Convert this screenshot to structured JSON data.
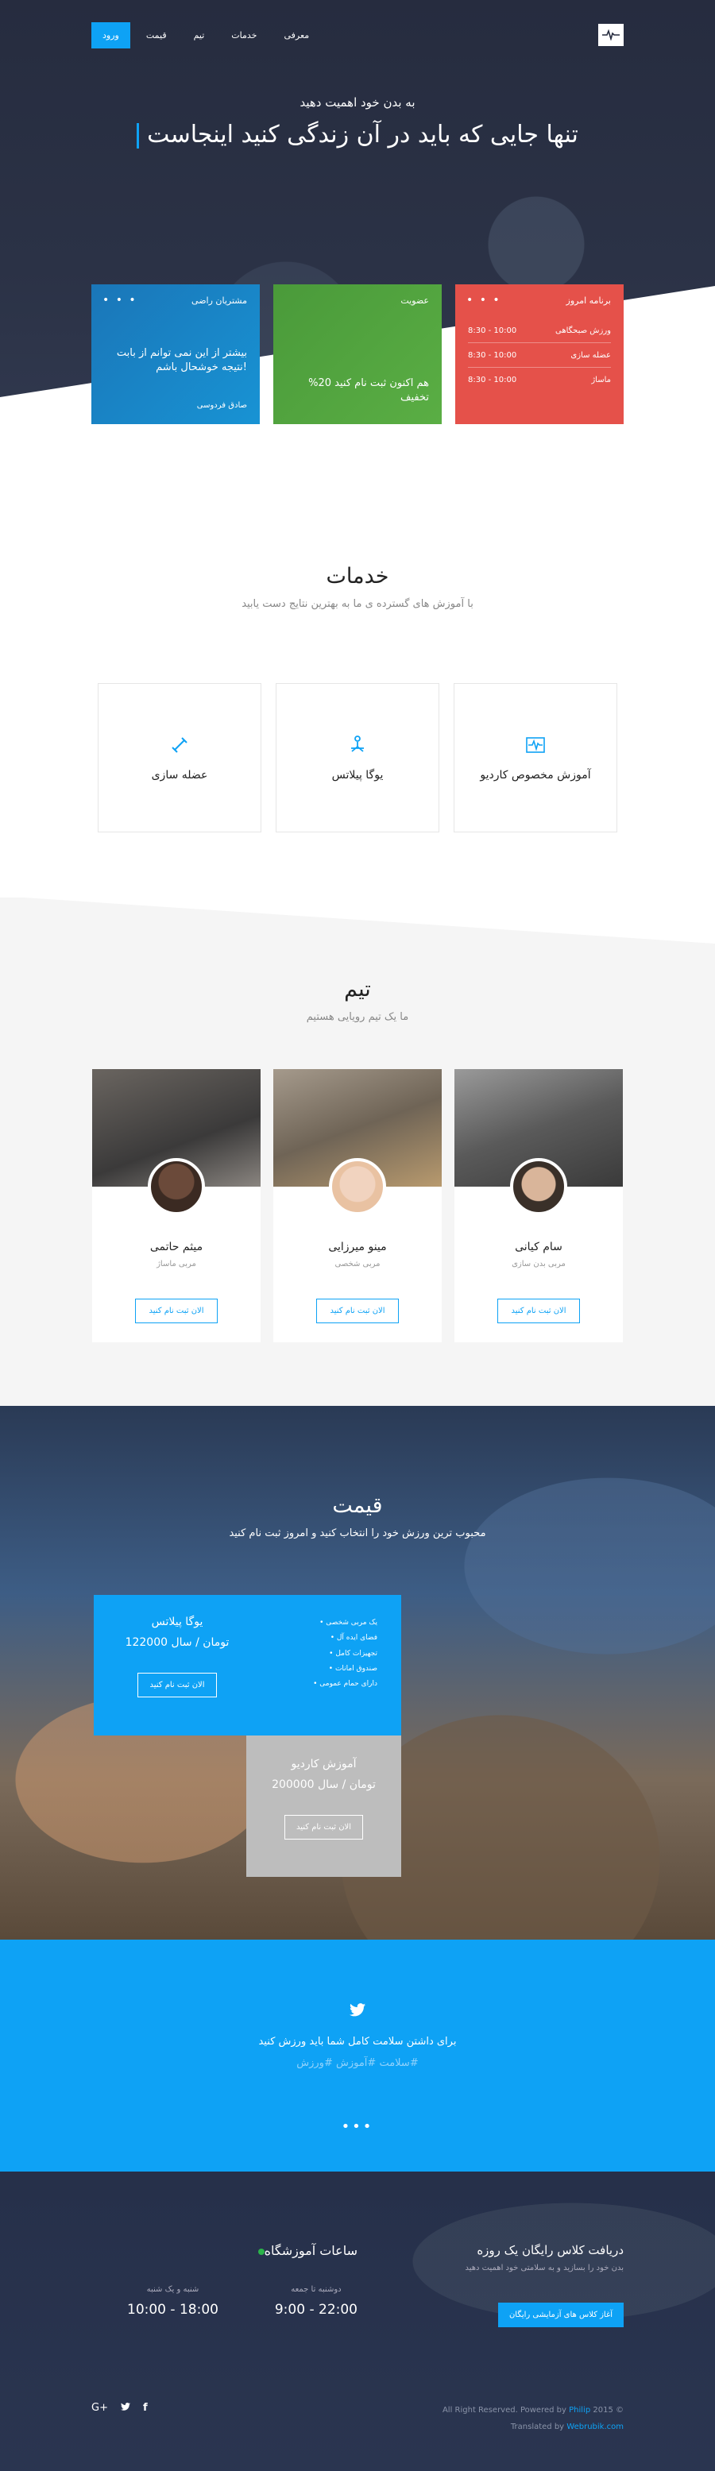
{
  "nav": {
    "items": [
      "ورود",
      "قیمت",
      "تیم",
      "خدمات",
      "معرفی"
    ]
  },
  "hero": {
    "subtitle": "به بدن خود اهمیت دهید",
    "title": "تنها جایی که باید در آن زندگی کنید اینجاست"
  },
  "features": {
    "testimonial": {
      "title": "مشتریان راضی",
      "quote": "بیشتر از این نمی توانم از بابت نتیجه خوشحال باشم!",
      "author": "صادق فردوسی"
    },
    "membership": {
      "title": "عضویت",
      "body": "هم اکنون ثبت نام کنید 20% تخفیف"
    },
    "schedule": {
      "title": "برنامه امروز",
      "rows": [
        {
          "name": "ورزش صبحگاهی",
          "time": "8:30 - 10:00"
        },
        {
          "name": "عضله سازی",
          "time": "8:30 - 10:00"
        },
        {
          "name": "ماساژ",
          "time": "8:30 - 10:00"
        }
      ]
    }
  },
  "services": {
    "title": "خدمات",
    "subtitle": "با آموزش های گسترده ی ما به بهترین نتایج دست یابید",
    "items": [
      {
        "label": "عضله سازی",
        "icon": "dumbbell-icon"
      },
      {
        "label": "یوگا پیلاتس",
        "icon": "yoga-icon"
      },
      {
        "label": "آموزش مخصوص کاردیو",
        "icon": "heartbeat-icon"
      }
    ]
  },
  "team": {
    "title": "تیم",
    "subtitle": "ما یک تیم رویایی هستیم",
    "members": [
      {
        "name": "میثم حاتمی",
        "role": "مربی ماساژ",
        "button": "الان ثبت نام کنید"
      },
      {
        "name": "مینو میرزایی",
        "role": "مربی شخصی",
        "button": "الان ثبت نام کنید"
      },
      {
        "name": "سام کیانی",
        "role": "مربی بدن سازی",
        "button": "الان ثبت نام کنید"
      }
    ]
  },
  "pricing": {
    "title": "قیمت",
    "subtitle": "محبوب ترین ورزش خود را انتخاب کنید و امروز ثبت نام کنید",
    "plan1": {
      "name": "یوگا پیلاتس",
      "price": "122000 تومان / سال",
      "button": "الان ثبت نام کنید",
      "features": [
        "یک مربی شخصی",
        "فضای ایده آل",
        "تجهیزات کامل",
        "صندوق امانات",
        "دارای حمام عمومی"
      ]
    },
    "plan2": {
      "name": "آموزش کاردیو",
      "price": "200000 تومان / سال",
      "button": "الان ثبت نام کنید"
    }
  },
  "testimonial": {
    "text": "برای داشتن سلامت کامل شما باید ورزش کنید",
    "tags": "سلامت #آموزش #ورزش#"
  },
  "footer": {
    "cta_title": "دریافت کلاس رایگان یک روزه",
    "cta_sub": "بدن خود را بسازید و به سلامتی خود اهمیت دهید",
    "cta_button": "آغاز کلاس های آزمایشی رایگان",
    "hours_title": "ساعات آموزشگاه",
    "hours": [
      {
        "days": "شنبه و یک شنبه",
        "time": "18:00 - 10:00"
      },
      {
        "days": "دوشنبه تا جمعه",
        "time": "22:00 - 9:00"
      }
    ],
    "copyright_pre": "All Right Reserved. Powered by",
    "copyright_brand": "Philip",
    "copyright_year": "2015 ©",
    "translated_pre": "Translated by",
    "translated_brand": "Webrubik.com"
  },
  "colors": {
    "accent": "#0ea2f5",
    "red": "#e5514a",
    "green": "#5aae44",
    "dark": "#262c3f"
  }
}
